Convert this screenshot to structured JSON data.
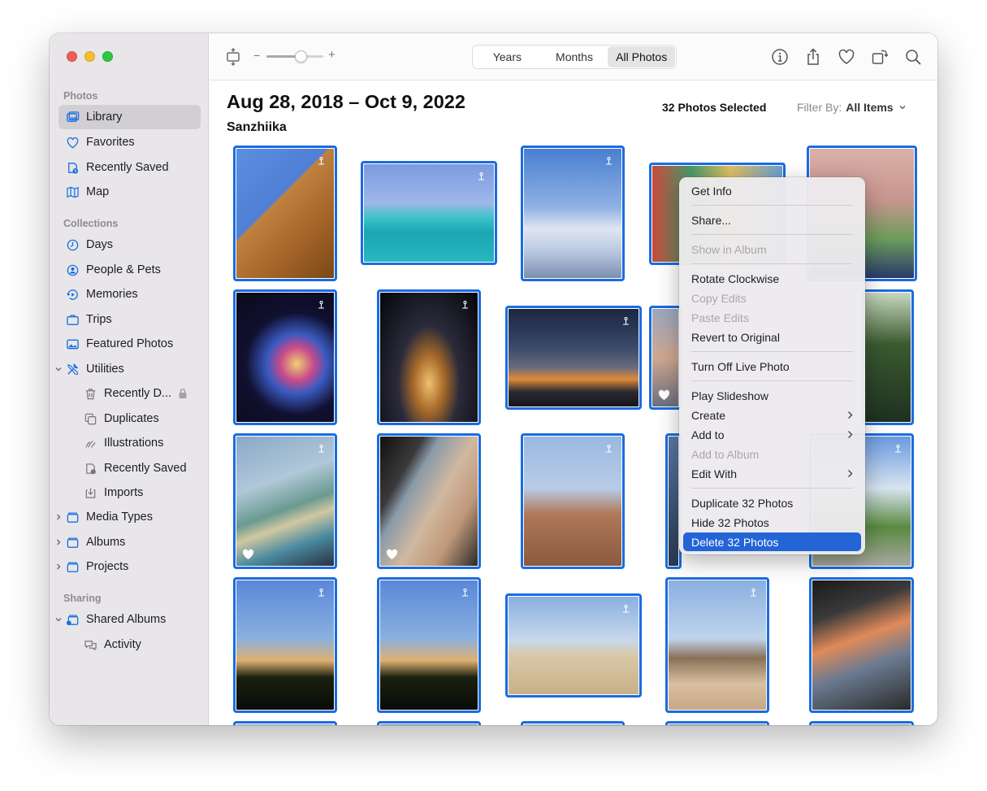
{
  "sidebar": {
    "sections": {
      "photos": "Photos",
      "collections": "Collections",
      "sharing": "Sharing"
    },
    "items": {
      "library": "Library",
      "favorites": "Favorites",
      "recently_saved": "Recently Saved",
      "map": "Map",
      "days": "Days",
      "people_pets": "People & Pets",
      "memories": "Memories",
      "trips": "Trips",
      "featured_photos": "Featured Photos",
      "utilities": "Utilities",
      "recently_deleted": "Recently D...",
      "duplicates": "Duplicates",
      "illustrations": "Illustrations",
      "recently_saved_util": "Recently Saved",
      "imports": "Imports",
      "media_types": "Media Types",
      "albums": "Albums",
      "projects": "Projects",
      "shared_albums": "Shared Albums",
      "activity": "Activity"
    }
  },
  "toolbar": {
    "zoom_minus": "−",
    "zoom_plus": "+",
    "zoom_level": 0.6,
    "segments": [
      "Years",
      "Months",
      "All Photos"
    ],
    "active_segment": "All Photos"
  },
  "header": {
    "title": "Aug 28, 2018 – Oct 9, 2022",
    "subtitle": "Sanzhiika",
    "selected_count": "32 Photos Selected",
    "filter_label": "Filter By:",
    "filter_value": "All Items"
  },
  "menu": {
    "get_info": "Get Info",
    "share": "Share...",
    "show_in_album": "Show in Album",
    "rotate_clockwise": "Rotate Clockwise",
    "copy_edits": "Copy Edits",
    "paste_edits": "Paste Edits",
    "revert_to_original": "Revert to Original",
    "turn_off_live_photo": "Turn Off Live Photo",
    "play_slideshow": "Play Slideshow",
    "create": "Create",
    "add_to": "Add to",
    "add_to_album": "Add to Album",
    "edit_with": "Edit With",
    "duplicate": "Duplicate 32 Photos",
    "hide": "Hide 32 Photos",
    "delete": "Delete 32 Photos"
  },
  "colors": {
    "selection_border": "#1b6ce0",
    "menu_highlight": "#2364d6"
  }
}
